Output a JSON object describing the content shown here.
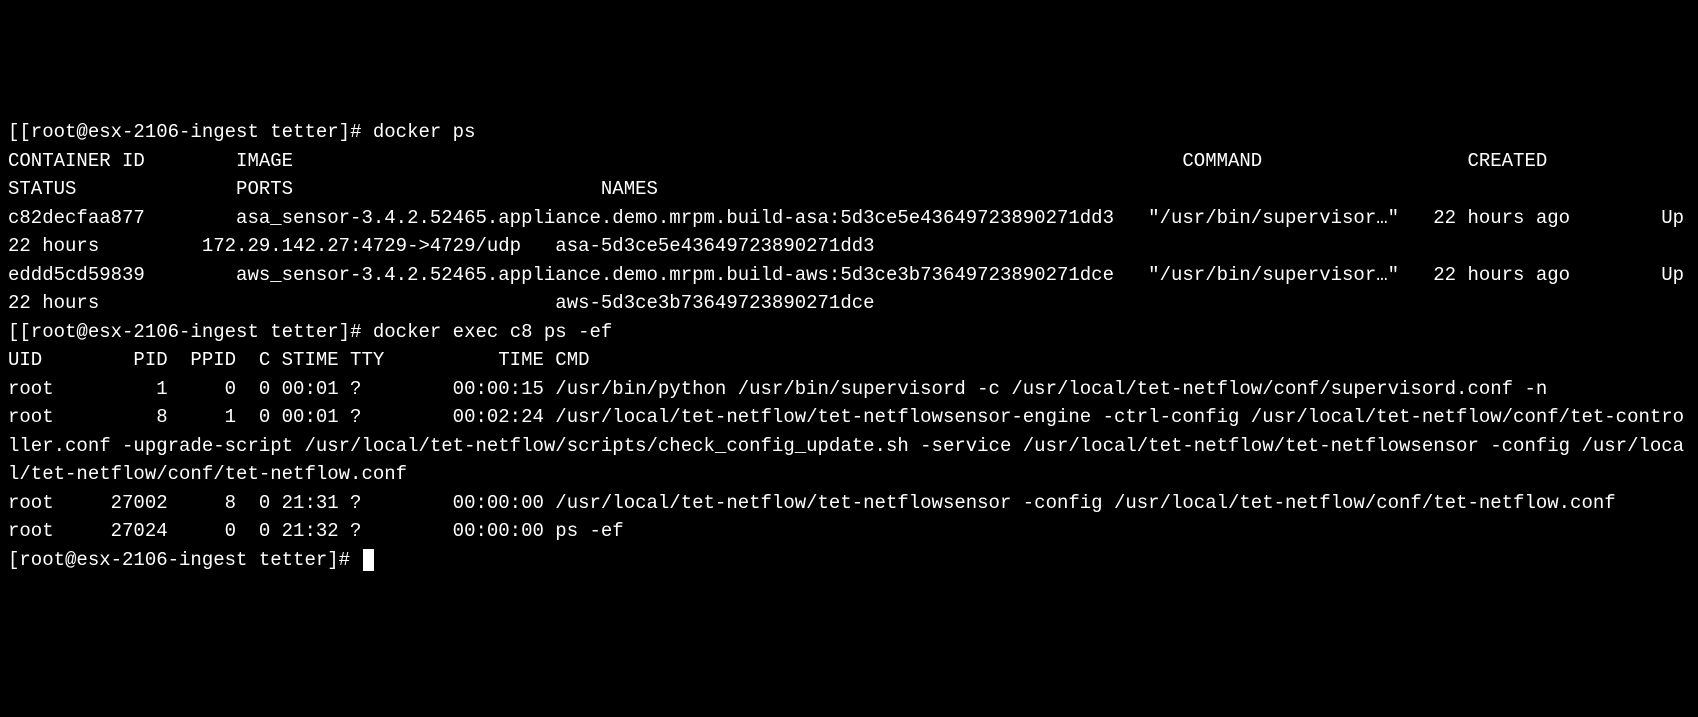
{
  "prompt1": {
    "bracket_open": "[",
    "user_host": "[root@esx-2106-ingest tetter]",
    "hash": "#",
    "command": " docker ps"
  },
  "docker_ps_header": "CONTAINER ID        IMAGE                                                                              COMMAND                  CREATED             STATUS              PORTS                           NAMES",
  "docker_ps_rows": [
    "c82decfaa877        asa_sensor-3.4.2.52465.appliance.demo.mrpm.build-asa:5d3ce5e43649723890271dd3   \"/usr/bin/supervisor…\"   22 hours ago        Up 22 hours         172.29.142.27:4729->4729/udp   asa-5d3ce5e43649723890271dd3",
    "eddd5cd59839        aws_sensor-3.4.2.52465.appliance.demo.mrpm.build-aws:5d3ce3b73649723890271dce   \"/usr/bin/supervisor…\"   22 hours ago        Up 22 hours                                        aws-5d3ce3b73649723890271dce"
  ],
  "prompt2": {
    "bracket_open": "[",
    "user_host": "[root@esx-2106-ingest tetter]",
    "hash": "#",
    "command": " docker exec c8 ps -ef",
    "trail": "]"
  },
  "ps_header": "UID        PID  PPID  C STIME TTY          TIME CMD",
  "ps_rows": [
    "root         1     0  0 00:01 ?        00:00:15 /usr/bin/python /usr/bin/supervisord -c /usr/local/tet-netflow/conf/supervisord.conf -n",
    "root         8     1  0 00:01 ?        00:02:24 /usr/local/tet-netflow/tet-netflowsensor-engine -ctrl-config /usr/local/tet-netflow/conf/tet-controller.conf -upgrade-script /usr/local/tet-netflow/scripts/check_config_update.sh -service /usr/local/tet-netflow/tet-netflowsensor -config /usr/local/tet-netflow/conf/tet-netflow.conf",
    "root     27002     8  0 21:31 ?        00:00:00 /usr/local/tet-netflow/tet-netflowsensor -config /usr/local/tet-netflow/conf/tet-netflow.conf",
    "root     27024     0  0 21:32 ?        00:00:00 ps -ef"
  ],
  "prompt3": {
    "user_host": "[root@esx-2106-ingest tetter]",
    "hash": "#"
  }
}
